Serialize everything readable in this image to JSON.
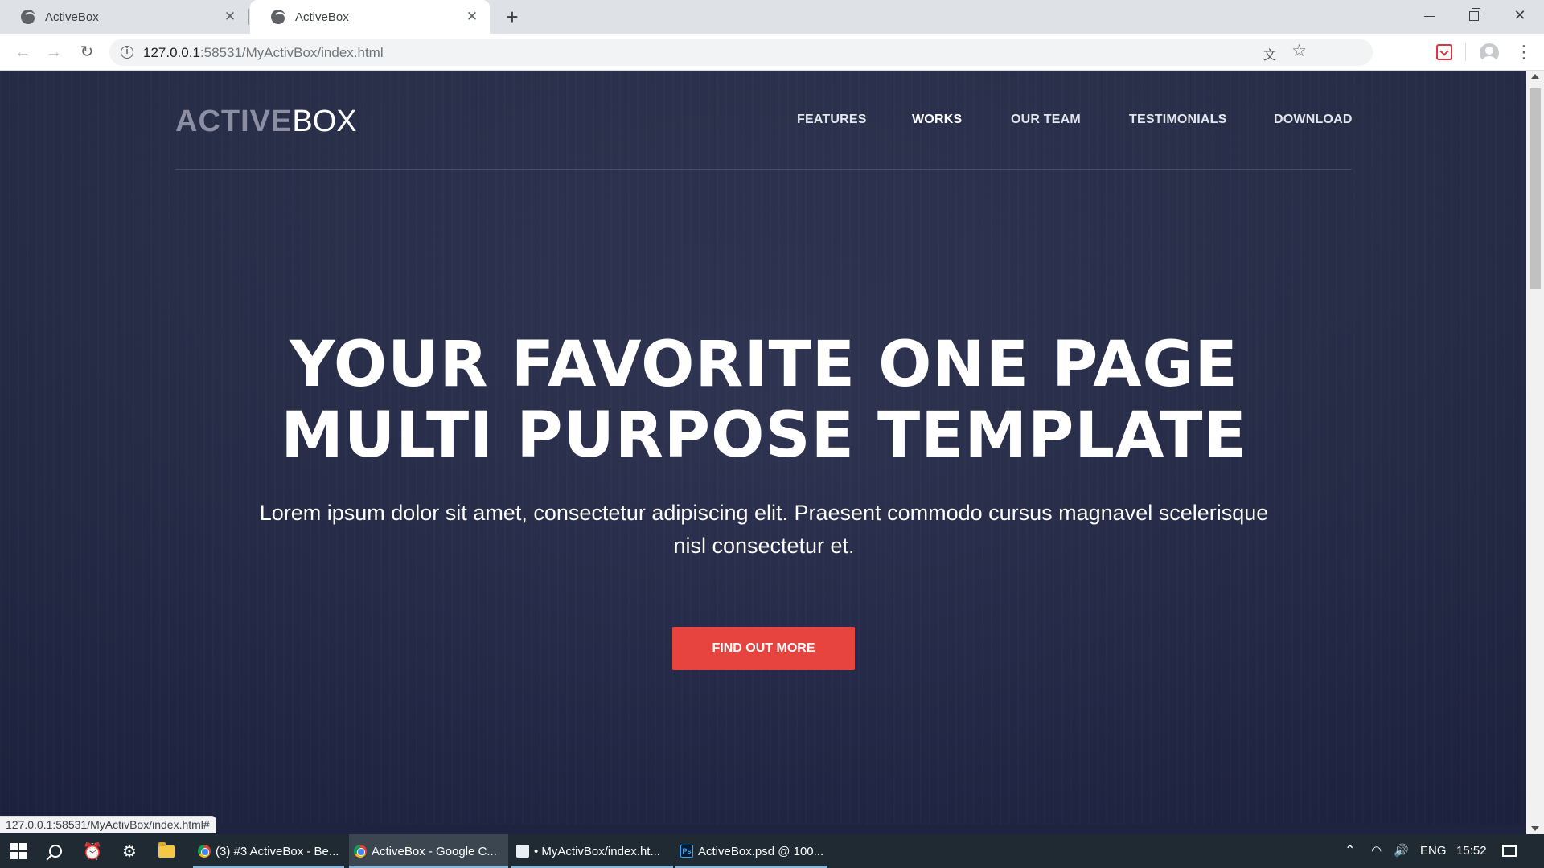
{
  "browser": {
    "tabs": [
      {
        "title": "ActiveBox",
        "active": false
      },
      {
        "title": "ActiveBox",
        "active": true
      }
    ],
    "new_tab_icon": "+",
    "url_host": "127.0.0.1",
    "url_rest": ":58531/MyActivBox/index.html",
    "status_url": "127.0.0.1:58531/MyActivBox/index.html#"
  },
  "page": {
    "logo_bold": "ACTIVE",
    "logo_light": "BOX",
    "nav": [
      {
        "label": "FEATURES",
        "active": false
      },
      {
        "label": "WORKS",
        "active": true
      },
      {
        "label": "OUR TEAM",
        "active": false
      },
      {
        "label": "TESTIMONIALS",
        "active": false
      },
      {
        "label": "DOWNLOAD",
        "active": false
      }
    ],
    "hero_title_line1": "YOUR FAVORITE ONE PAGE",
    "hero_title_line2": "MULTI PURPOSE TEMPLATE",
    "hero_subtitle": "Lorem ipsum dolor sit amet, consectetur adipiscing elit. Praesent commodo cursus magnavel scelerisque nisl consectetur et.",
    "cta_label": "FIND OUT MORE",
    "colors": {
      "background": "#272d4b",
      "cta": "#e8443f",
      "text": "#ffffff",
      "logo_bold": "#8c8fa3"
    }
  },
  "taskbar": {
    "tasks": [
      {
        "label": "(3) #3 ActiveBox - Be...",
        "icon": "chrome-icon",
        "active": false
      },
      {
        "label": "ActiveBox - Google C...",
        "icon": "chrome-icon",
        "active": true
      },
      {
        "label": "• MyActivBox/index.ht...",
        "icon": "typora-icon",
        "active": false
      },
      {
        "label": "ActiveBox.psd @ 100...",
        "icon": "photoshop-icon",
        "active": false
      }
    ],
    "lang": "ENG",
    "time": "15:52"
  }
}
